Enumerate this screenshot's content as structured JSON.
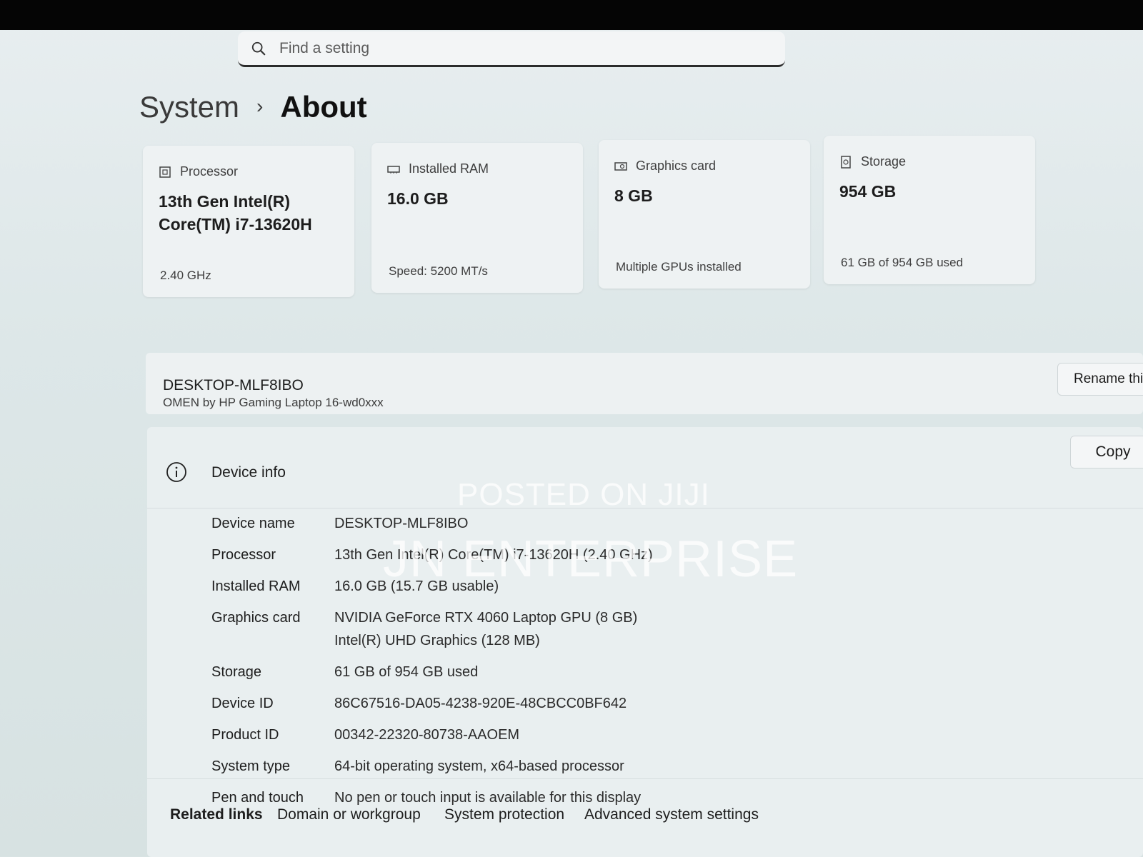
{
  "search": {
    "placeholder": "Find a setting",
    "icon": "search-icon"
  },
  "breadcrumb": {
    "parent": "System",
    "separator": "›",
    "current": "About"
  },
  "spec_cards": [
    {
      "icon": "processor-icon",
      "title": "Processor",
      "value": "13th Gen Intel(R) Core(TM) i7-13620H",
      "sub": "2.40 GHz"
    },
    {
      "icon": "ram-icon",
      "title": "Installed RAM",
      "value": "16.0 GB",
      "sub": "Speed: 5200 MT/s"
    },
    {
      "icon": "graphics-card-icon",
      "title": "Graphics card",
      "value": "8 GB",
      "sub": "Multiple GPUs installed"
    },
    {
      "icon": "storage-icon",
      "title": "Storage",
      "value": "954 GB",
      "sub": "61 GB of 954 GB used"
    }
  ],
  "device_header": {
    "name": "DESKTOP-MLF8IBO",
    "model": "OMEN by HP Gaming Laptop 16-wd0xxx",
    "rename_label": "Rename thi"
  },
  "device_info": {
    "icon": "info-icon",
    "title": "Device info",
    "copy_label": "Copy",
    "rows": [
      {
        "label": "Device name",
        "values": [
          "DESKTOP-MLF8IBO"
        ]
      },
      {
        "label": "Processor",
        "values": [
          "13th Gen Intel(R) Core(TM) i7-13620H (2.40 GHz)"
        ]
      },
      {
        "label": "Installed RAM",
        "values": [
          "16.0 GB (15.7 GB usable)"
        ]
      },
      {
        "label": "Graphics card",
        "values": [
          "NVIDIA GeForce RTX 4060 Laptop GPU (8 GB)",
          "Intel(R) UHD Graphics (128 MB)"
        ]
      },
      {
        "label": "Storage",
        "values": [
          "61 GB of 954 GB used"
        ]
      },
      {
        "label": "Device ID",
        "values": [
          "86C67516-DA05-4238-920E-48CBCC0BF642"
        ]
      },
      {
        "label": "Product ID",
        "values": [
          "00342-22320-80738-AAOEM"
        ]
      },
      {
        "label": "System type",
        "values": [
          "64-bit operating system, x64-based processor"
        ]
      },
      {
        "label": "Pen and touch",
        "values": [
          "No pen or touch input is available for this display"
        ]
      }
    ]
  },
  "related_links": {
    "lead": "Related links",
    "items": [
      "Domain or workgroup",
      "System protection",
      "Advanced system settings"
    ]
  },
  "watermark": {
    "line1": "POSTED ON JIJI",
    "line2": "JN ENTERPRISE"
  }
}
